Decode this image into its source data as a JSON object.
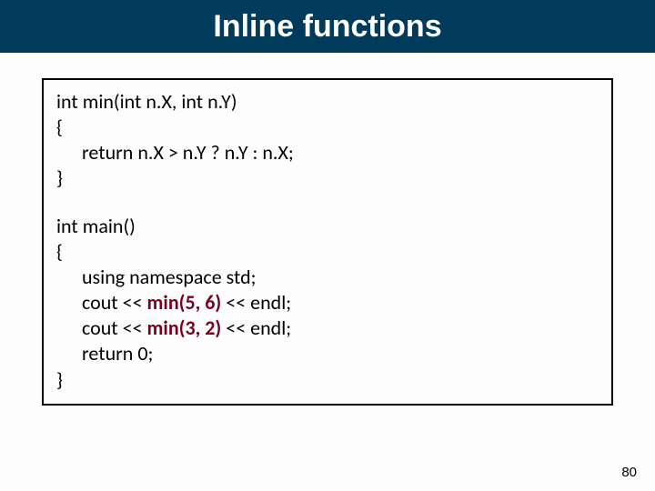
{
  "title": "Inline functions",
  "code": {
    "l1": "int min(int n.X, int n.Y)",
    "l2": "{",
    "l3": "return n.X > n.Y ? n.Y : n.X;",
    "l4": "}",
    "l5": "int main()",
    "l6": "{",
    "l7": "using namespace std;",
    "l8a": "cout << ",
    "l8b": "min(5, 6)",
    "l8c": " << endl;",
    "l9a": "cout << ",
    "l9b": "min(3, 2)",
    "l9c": " << endl;",
    "l10": "return 0;",
    "l11": "}"
  },
  "page_number": "80"
}
